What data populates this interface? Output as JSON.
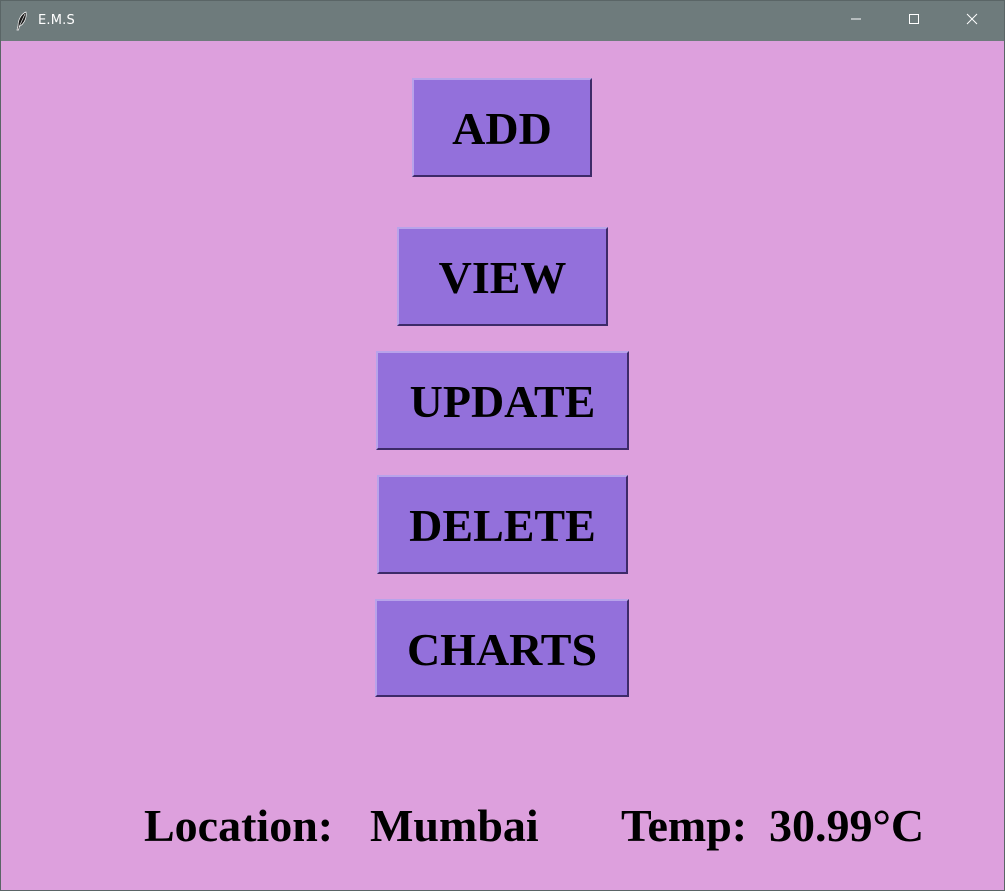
{
  "window": {
    "title": "E.M.S",
    "title_icon": "feather-icon",
    "controls": {
      "minimize_icon": "minimize-icon",
      "maximize_icon": "maximize-icon",
      "close_icon": "close-icon"
    }
  },
  "buttons": {
    "add": "ADD",
    "view": "VIEW",
    "update": "UPDATE",
    "delete": "DELETE",
    "charts": "CHARTS"
  },
  "footer": {
    "location_label": "Location:",
    "location_value": "Mumbai",
    "temp_label": "Temp:",
    "temp_value": "30.99°C"
  },
  "colors": {
    "background": "#dda0dd",
    "button": "#9370db",
    "titlebar": "#6e7b7c",
    "text": "#000000"
  }
}
